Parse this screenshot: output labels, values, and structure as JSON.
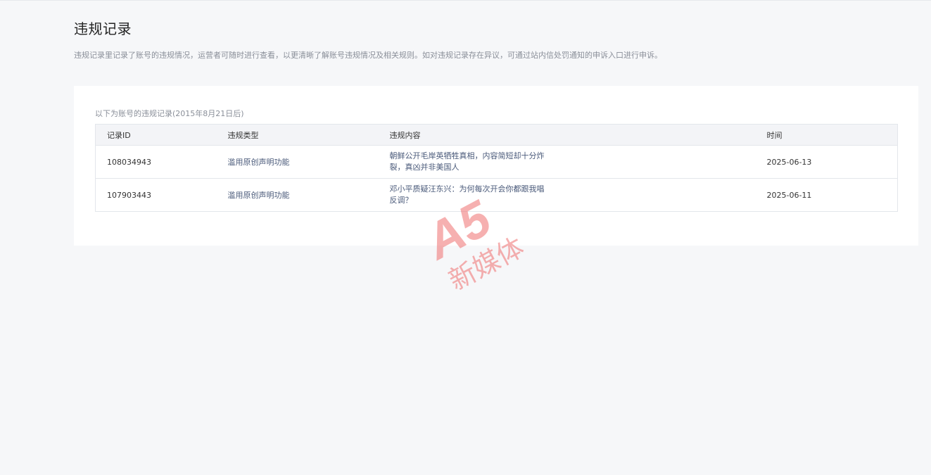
{
  "page": {
    "title": "违规记录",
    "description": "违规记录里记录了账号的违规情况，运营者可随时进行查看，以更清晰了解账号违规情况及相关规则。如对违规记录存在异议，可通过站内信处罚通知的申诉入口进行申诉。"
  },
  "records": {
    "caption": "以下为账号的违规记录(2015年8月21日后)",
    "columns": [
      "记录ID",
      "违规类型",
      "违规内容",
      "时间"
    ],
    "rows": [
      {
        "id": "108034943",
        "type": "滥用原创声明功能",
        "content": "朝鲜公开毛岸英牺牲真相，内容简短却十分炸裂，真凶并非美国人",
        "time": "2025-06-13"
      },
      {
        "id": "107903443",
        "type": "滥用原创声明功能",
        "content": "邓小平质疑汪东兴：为何每次开会你都跟我唱反调？",
        "time": "2025-06-11"
      }
    ]
  },
  "watermark": {
    "logo_text": "A5",
    "subtitle": "新媒体",
    "color": "#f07070"
  }
}
